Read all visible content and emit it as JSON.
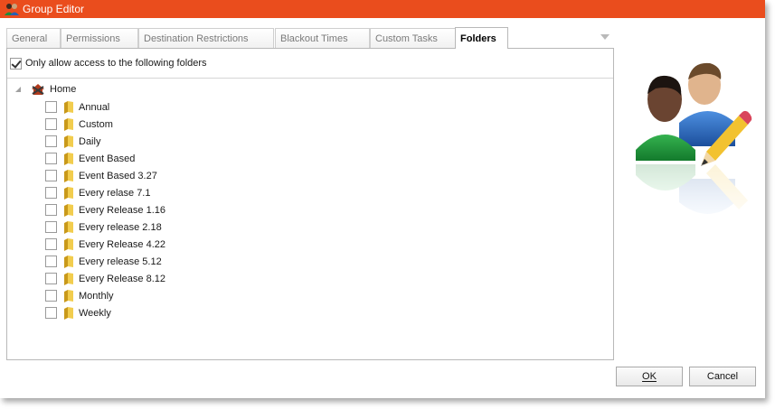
{
  "window": {
    "title": "Group Editor"
  },
  "tabs": [
    {
      "label": "General",
      "active": false
    },
    {
      "label": "Permissions",
      "active": false
    },
    {
      "label": "Destination Restrictions",
      "active": false
    },
    {
      "label": "Blackout Times",
      "active": false
    },
    {
      "label": "Custom Tasks",
      "active": false
    },
    {
      "label": "Folders",
      "active": true
    }
  ],
  "folders": {
    "only_allow_label": "Only allow access to the following folders",
    "only_allow_checked": true,
    "root": {
      "label": "Home",
      "icon": "home-folder-icon"
    },
    "items": [
      {
        "label": "Annual",
        "checked": false
      },
      {
        "label": "Custom",
        "checked": false
      },
      {
        "label": "Daily",
        "checked": false
      },
      {
        "label": "Event Based",
        "checked": false
      },
      {
        "label": "Event Based 3.27",
        "checked": false
      },
      {
        "label": "Every relase 7.1",
        "checked": false
      },
      {
        "label": "Every Release 1.16",
        "checked": false
      },
      {
        "label": "Every release 2.18",
        "checked": false
      },
      {
        "label": "Every Release 4.22",
        "checked": false
      },
      {
        "label": "Every release 5.12",
        "checked": false
      },
      {
        "label": "Every Release 8.12",
        "checked": false
      },
      {
        "label": "Monthly",
        "checked": false
      },
      {
        "label": "Weekly",
        "checked": false
      }
    ]
  },
  "buttons": {
    "ok_label": "OK",
    "cancel_label": "Cancel"
  },
  "colors": {
    "titlebar": "#ea4d1d",
    "folder": "#e8b923"
  }
}
